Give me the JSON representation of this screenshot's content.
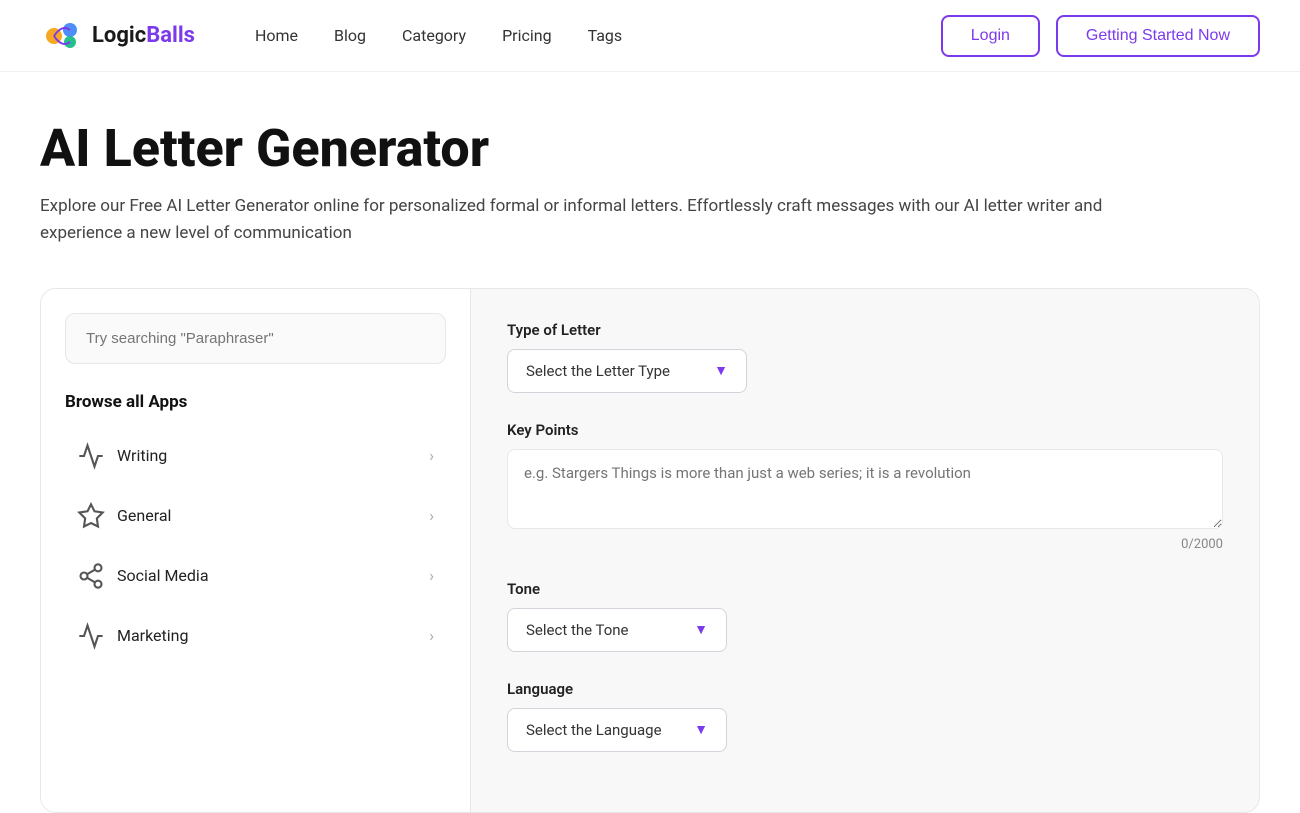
{
  "navbar": {
    "logo_text_logic": "Logic",
    "logo_text_balls": "Balls",
    "nav_links": [
      {
        "label": "Home",
        "id": "home"
      },
      {
        "label": "Blog",
        "id": "blog"
      },
      {
        "label": "Category",
        "id": "category"
      },
      {
        "label": "Pricing",
        "id": "pricing"
      },
      {
        "label": "Tags",
        "id": "tags"
      }
    ],
    "login_label": "Login",
    "get_started_label": "Getting Started Now"
  },
  "main": {
    "title": "AI Letter Generator",
    "description": "Explore our Free AI Letter Generator online for personalized formal or informal letters. Effortlessly craft messages with our AI letter writer and experience a new level of communication"
  },
  "left_panel": {
    "search_placeholder": "Try searching \"Paraphraser\"",
    "browse_title": "Browse all Apps",
    "apps": [
      {
        "label": "Writing",
        "id": "writing"
      },
      {
        "label": "General",
        "id": "general"
      },
      {
        "label": "Social Media",
        "id": "social-media"
      },
      {
        "label": "Marketing",
        "id": "marketing"
      }
    ]
  },
  "right_panel": {
    "type_of_letter_label": "Type of Letter",
    "type_of_letter_placeholder": "Select the Letter Type",
    "key_points_label": "Key Points",
    "key_points_placeholder": "e.g. Stargers Things is more than just a web series; it is a revolution",
    "char_count": "0/2000",
    "tone_label": "Tone",
    "tone_placeholder": "Select the Tone",
    "language_label": "Language",
    "language_placeholder": "Select the Language"
  }
}
